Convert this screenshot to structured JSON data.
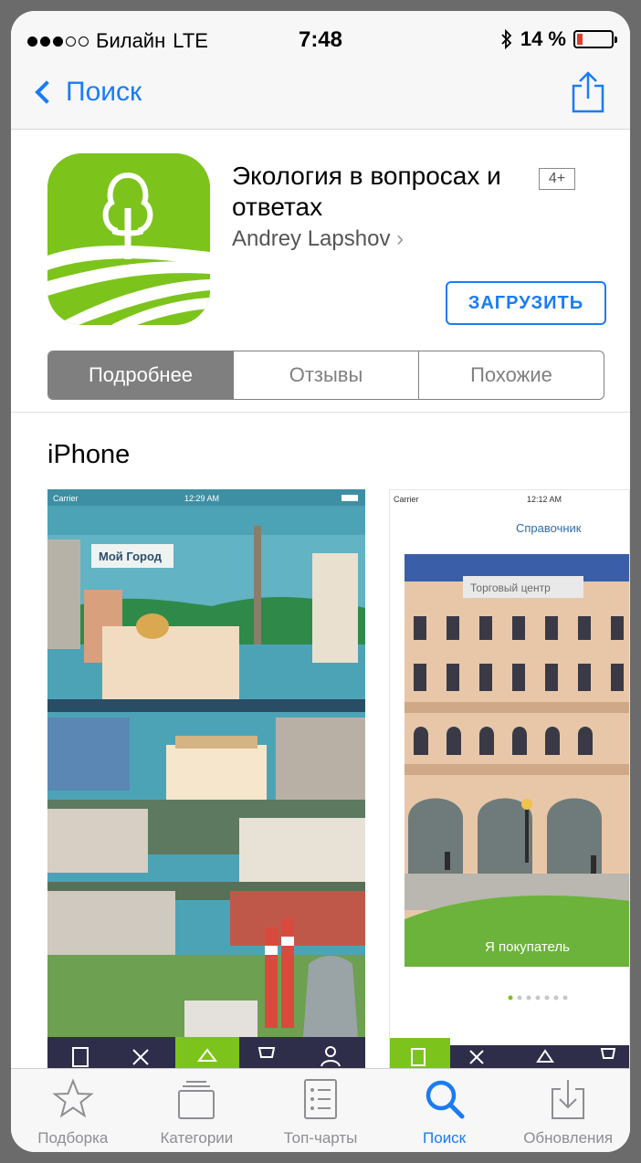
{
  "status_bar": {
    "carrier": "Билайн",
    "network": "LTE",
    "time": "7:48",
    "battery": "14 %"
  },
  "nav": {
    "back_label": "Поиск",
    "share_icon": "share-icon"
  },
  "app": {
    "title": "Экология в вопросах и ответах",
    "age_rating": "4+",
    "developer": "Andrey Lapshov",
    "developer_chevron": "›",
    "get_button": "ЗАГРУЗИТЬ",
    "icon": "tree-field-icon",
    "accent": "#1a7cf5",
    "icon_color": "#7cc41c"
  },
  "segments": [
    {
      "label": "Подробнее",
      "selected": true
    },
    {
      "label": "Отзывы",
      "selected": false
    },
    {
      "label": "Похожие",
      "selected": false
    }
  ],
  "screenshots": {
    "section_title": "iPhone",
    "shot1": {
      "carrier": "Carrier",
      "time": "12:29 AM",
      "sign": "Мой Город"
    },
    "shot2": {
      "carrier": "Carrier",
      "time": "12:12 AM",
      "header": "Справочник",
      "sign": "Торговый центр",
      "caption": "Я покупатель"
    }
  },
  "tabbar": [
    {
      "label": "Подборка",
      "icon": "star-icon",
      "active": false
    },
    {
      "label": "Категории",
      "icon": "categories-icon",
      "active": false
    },
    {
      "label": "Топ-чарты",
      "icon": "list-icon",
      "active": false
    },
    {
      "label": "Поиск",
      "icon": "search-icon",
      "active": true
    },
    {
      "label": "Обновления",
      "icon": "download-icon",
      "active": false
    }
  ]
}
